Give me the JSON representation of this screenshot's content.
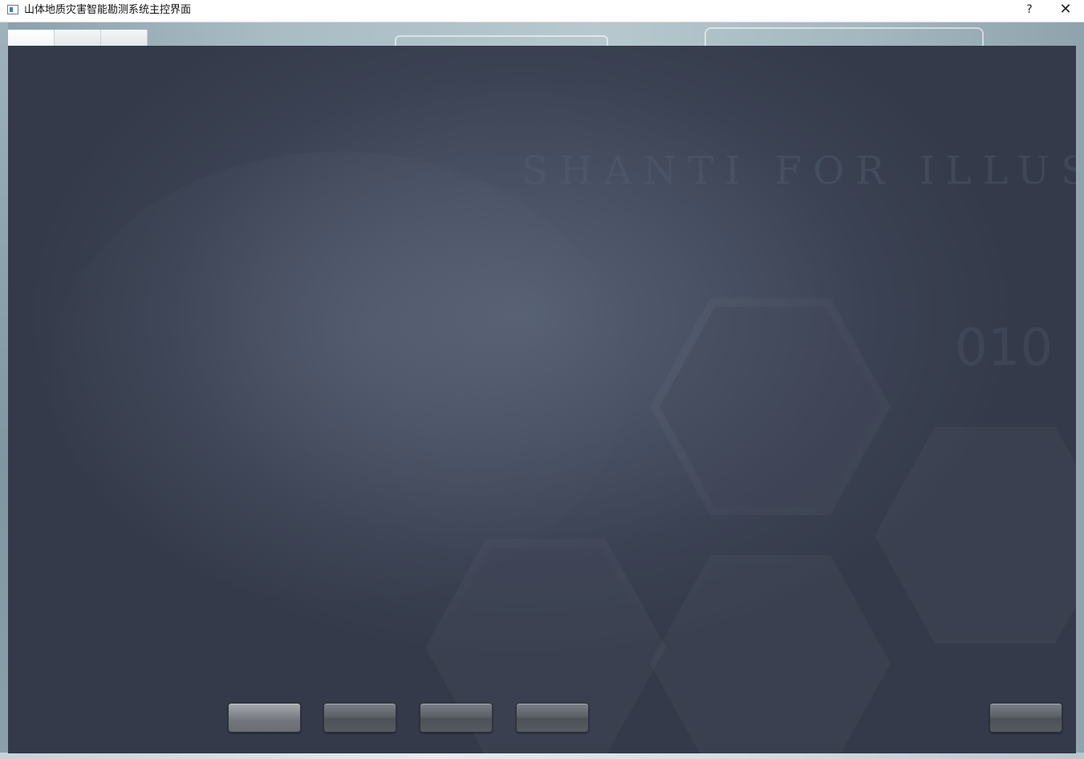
{
  "window": {
    "title": "山体地质灾害智能勘测系统主控界面",
    "help_label": "?",
    "close_label": "✕"
  },
  "tabs": [
    {
      "label": ""
    },
    {
      "label": ""
    },
    {
      "label": ""
    }
  ],
  "background": {
    "watermark_text": "SHANTI FOR ILLUSTRATION",
    "watermark_digits": "010"
  },
  "bottom_buttons": [
    {
      "label": ""
    },
    {
      "label": ""
    },
    {
      "label": ""
    },
    {
      "label": ""
    },
    {
      "label": ""
    }
  ],
  "colors": {
    "panel_dark": "#3b4253",
    "button": "#5c6168",
    "titlebar": "#ffffff"
  }
}
